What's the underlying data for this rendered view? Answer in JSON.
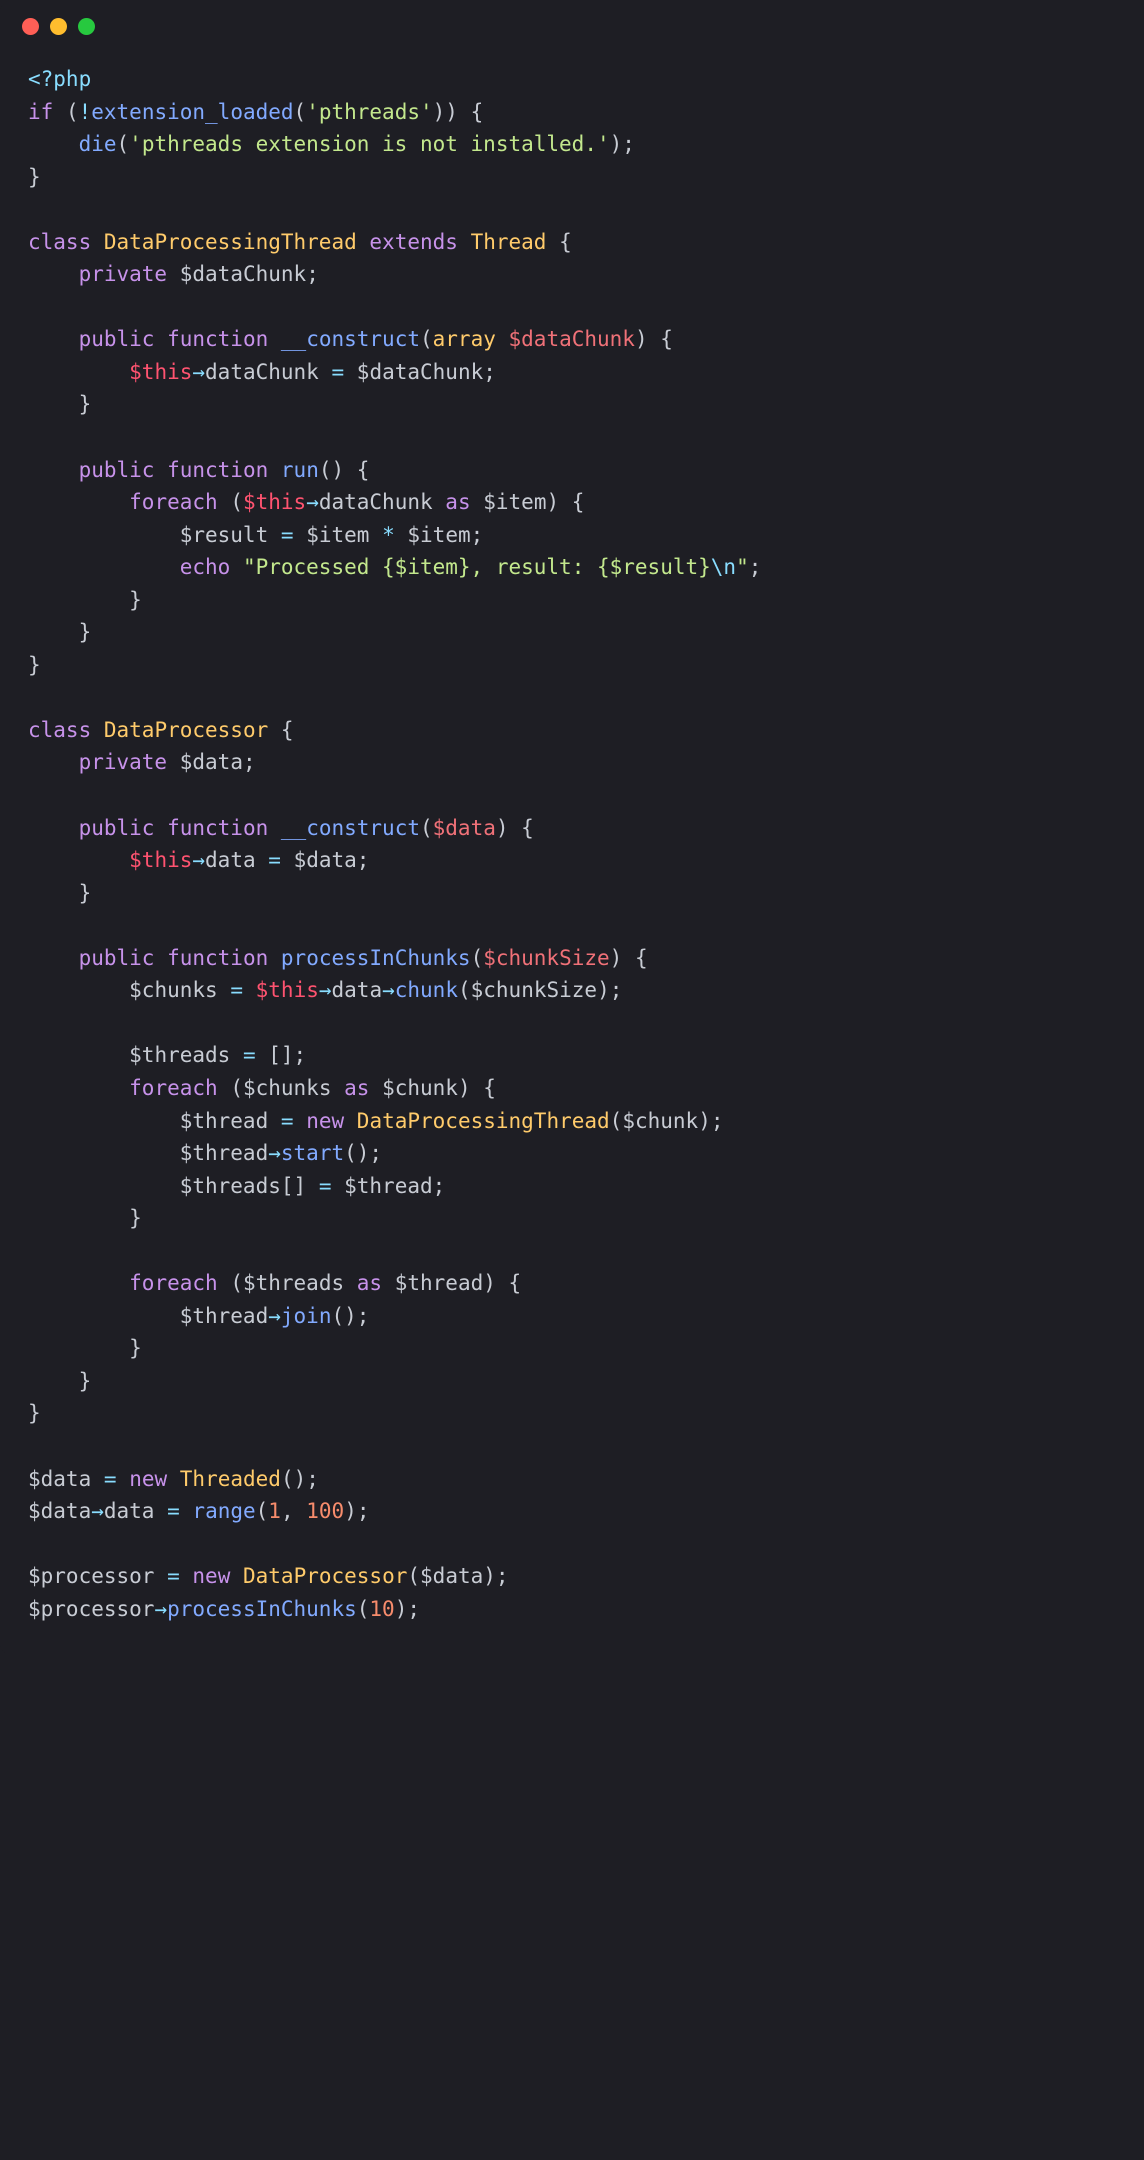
{
  "titlebar": {
    "buttons": [
      "close",
      "minimize",
      "maximize"
    ]
  },
  "code": {
    "line1_open": "<?php",
    "line2_if": "if",
    "line2_not": "!",
    "line2_fn": "extension_loaded",
    "line2_str": "'pthreads'",
    "line3_die": "die",
    "line3_str": "'pthreads extension is not installed.'",
    "line6_class": "class",
    "line6_name": "DataProcessingThread",
    "line6_extends": "extends",
    "line6_parent": "Thread",
    "line7_private": "private",
    "line7_var": "$dataChunk",
    "line9_public": "public",
    "line9_function": "function",
    "line9_name": "__construct",
    "line9_type": "array",
    "line9_param": "$dataChunk",
    "line10_this": "$this",
    "line10_arrow": "→",
    "line10_prop": "dataChunk",
    "line10_var": "$dataChunk",
    "line13_public": "public",
    "line13_function": "function",
    "line13_name": "run",
    "line14_foreach": "foreach",
    "line14_this": "$this",
    "line14_prop": "dataChunk",
    "line14_as": "as",
    "line14_item": "$item",
    "line15_result": "$result",
    "line15_item": "$item",
    "line16_echo": "echo",
    "line16_str1": "\"Processed ",
    "line16_interp1": "{$item}",
    "line16_str2": ", result: ",
    "line16_interp2": "{$result}",
    "line16_esc": "\\n",
    "line16_str3": "\"",
    "line21_class": "class",
    "line21_name": "DataProcessor",
    "line22_private": "private",
    "line22_var": "$data",
    "line24_public": "public",
    "line24_function": "function",
    "line24_name": "__construct",
    "line24_param": "$data",
    "line25_this": "$this",
    "line25_prop": "data",
    "line25_var": "$data",
    "line28_public": "public",
    "line28_function": "function",
    "line28_name": "processInChunks",
    "line28_param": "$chunkSize",
    "line29_chunks": "$chunks",
    "line29_this": "$this",
    "line29_prop": "data",
    "line29_method": "chunk",
    "line29_arg": "$chunkSize",
    "line31_threads": "$threads",
    "line32_foreach": "foreach",
    "line32_chunks": "$chunks",
    "line32_as": "as",
    "line32_chunk": "$chunk",
    "line33_thread": "$thread",
    "line33_new": "new",
    "line33_cls": "DataProcessingThread",
    "line33_arg": "$chunk",
    "line34_thread": "$thread",
    "line34_method": "start",
    "line35_threads": "$threads",
    "line35_thread": "$thread",
    "line38_foreach": "foreach",
    "line38_threads": "$threads",
    "line38_as": "as",
    "line38_thread": "$thread",
    "line39_thread": "$thread",
    "line39_method": "join",
    "line44_data": "$data",
    "line44_new": "new",
    "line44_cls": "Threaded",
    "line45_data": "$data",
    "line45_prop": "data",
    "line45_fn": "range",
    "line45_a": "1",
    "line45_b": "100",
    "line47_proc": "$processor",
    "line47_new": "new",
    "line47_cls": "DataProcessor",
    "line47_arg": "$data",
    "line48_proc": "$processor",
    "line48_method": "processInChunks",
    "line48_arg": "10"
  }
}
